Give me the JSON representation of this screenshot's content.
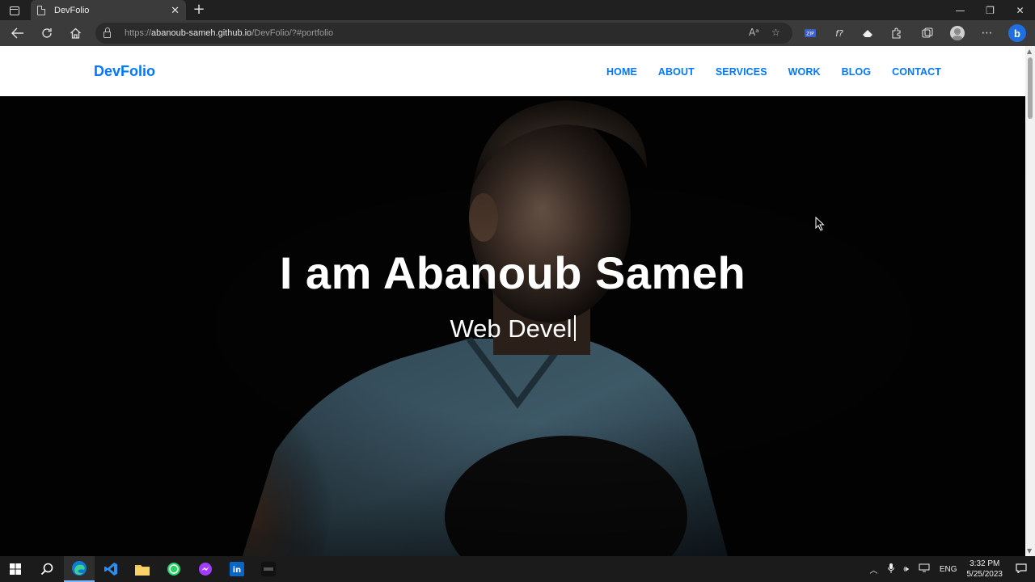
{
  "browser": {
    "tab_title": "DevFolio",
    "tab_close": "✕",
    "new_tab": "+",
    "url_prefix": "https://",
    "url_host": "abanoub-sameh.github.io",
    "url_path": "/DevFolio/?#portfolio",
    "window_controls": [
      "—",
      "❐",
      "✕"
    ]
  },
  "site": {
    "brand": "DevFolio",
    "nav": [
      "HOME",
      "ABOUT",
      "SERVICES",
      "WORK",
      "BLOG",
      "CONTACT"
    ],
    "hero_title": "I am Abanoub Sameh",
    "hero_subtitle": "Web Devel"
  },
  "taskbar": {
    "language": "ENG",
    "time": "3:32 PM",
    "date": "5/25/2023",
    "brand_color_edge": "#0d7ad6",
    "brand_color_vscode": "#2a8ff0",
    "brand_color_whatsapp": "#25d366",
    "brand_color_linkedin": "#0a66c2"
  },
  "colors": {
    "accent": "#0078ff",
    "chrome_dark": "#202020",
    "toolbar": "#3b3b3b"
  }
}
